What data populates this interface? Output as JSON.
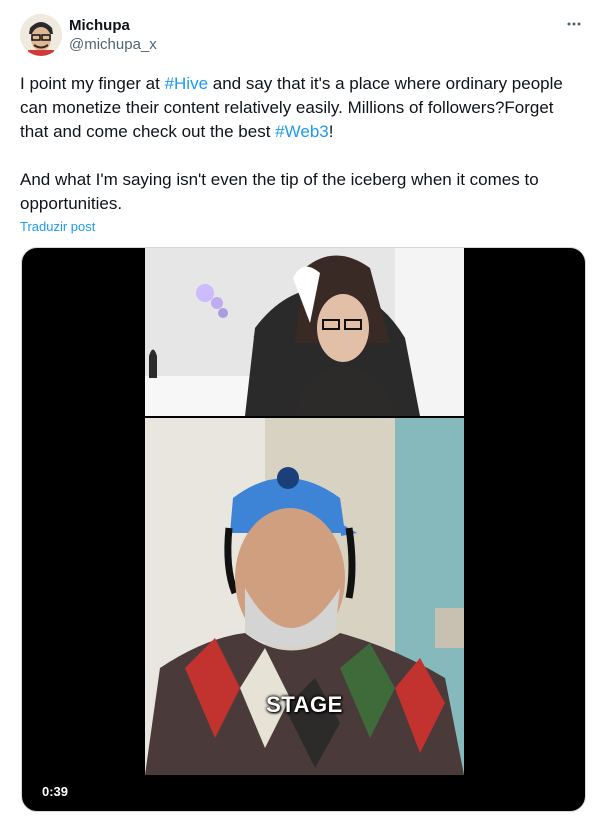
{
  "author": {
    "display_name": "Michupa",
    "handle": "@michupa_x",
    "more_icon": "more-horizontal-icon"
  },
  "tweet": {
    "p1_part1": "I point my finger at ",
    "hashtag1": "#Hive",
    "p1_part2": " and say that it's a place where ordinary people can monetize their content relatively easily. Millions of followers?Forget that and come check out the best ",
    "hashtag2": "#Web3",
    "p1_part3": "!",
    "p2": "And what I'm saying isn't even the tip of the iceberg when it comes to opportunities.",
    "translate_label": "Traduzir post"
  },
  "media": {
    "duration": "0:39",
    "caption": "STAGE"
  },
  "colors": {
    "link": "#1d9bf0",
    "text": "#0f1419",
    "secondary": "#536471"
  }
}
